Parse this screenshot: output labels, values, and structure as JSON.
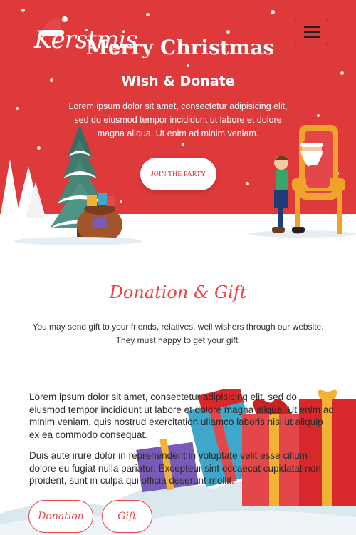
{
  "brand": {
    "logo_text": "Kerstmis"
  },
  "nav": {
    "menu_icon": "hamburger-menu-icon"
  },
  "hero": {
    "title": "Merry Christmas",
    "subtitle": "Wish & Donate",
    "text": "Lorem ipsum dolor sit amet, consectetur adipisicing elit, sed do eiusmod tempor incididunt ut labore et dolore magna aliqua. Ut enim ad minim veniam.",
    "cta_label": "JOIN THE PARTY"
  },
  "donation": {
    "title": "Donation & Gift",
    "text": "You may send gift to your friends, relatives, well wishers through our website. They must happy to get your gift.",
    "paragraph_1": "Lorem ipsum dolor sit amet, consectetur adipisicing elit, sed do eiusmod tempor incididunt ut labore et dolore magna aliqua. Ut enim ad minim veniam, quis nostrud exercitation ullamco laboris nisi ut aliquip ex ea commodo consequat.",
    "paragraph_2": "Duis aute irure dolor in reprehenderit in voluptate velit esse cillum dolore eu fugiat nulla pariatur. Excepteur sint occaecat cupidatat non proident, sunt in culpa qui officia deserunt mollit.",
    "buttons": [
      {
        "label": "Donation"
      },
      {
        "label": "Gift"
      }
    ]
  },
  "colors": {
    "accent": "#de3a3c",
    "heading": "#e3474a",
    "text": "#333333"
  }
}
